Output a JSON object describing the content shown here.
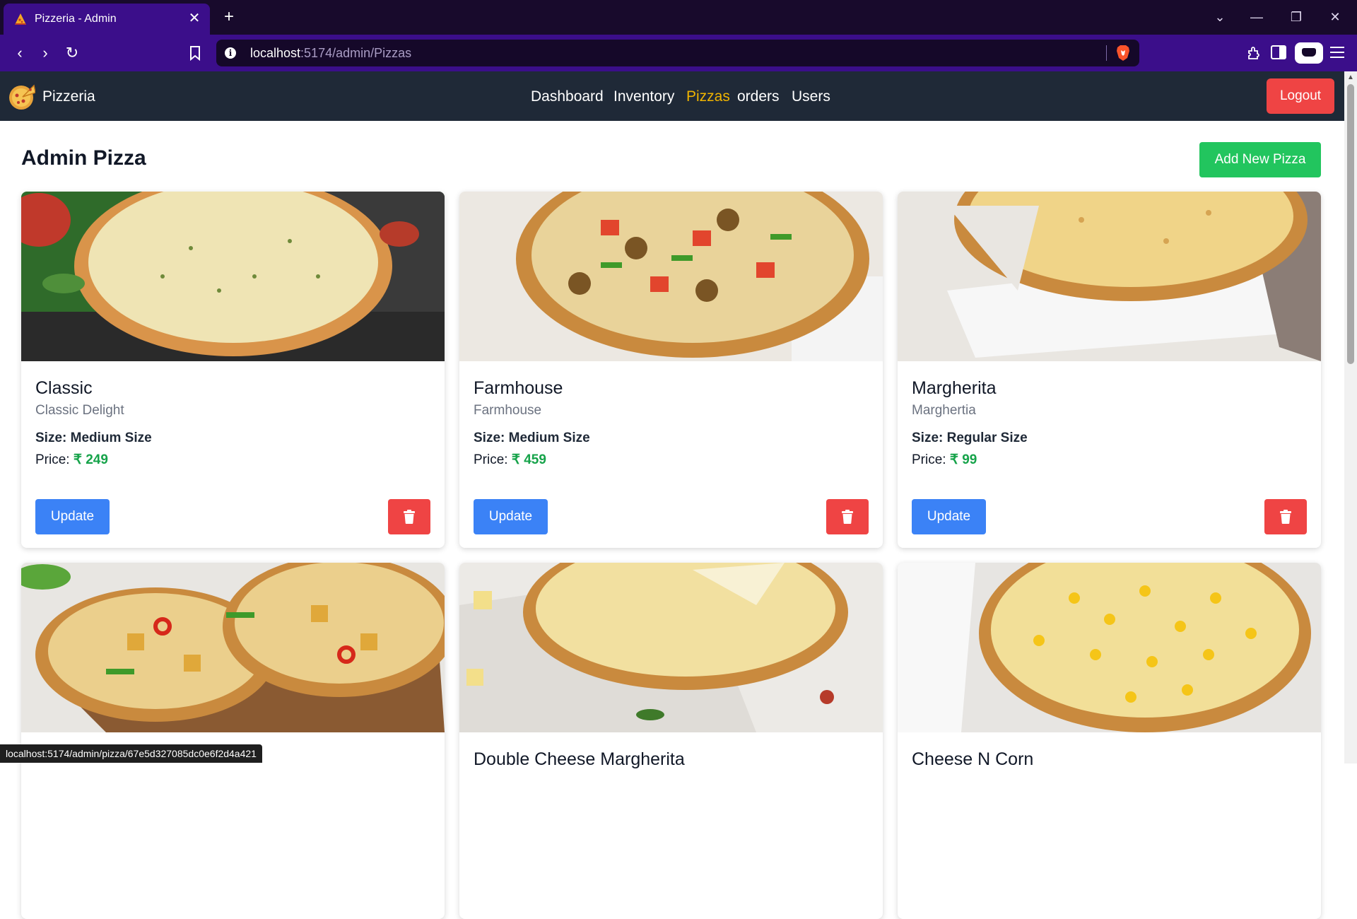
{
  "browser": {
    "tab_title": "Pizzeria - Admin",
    "url_host": "localhost",
    "url_path": ":5174/admin/Pizzas",
    "status_url": "localhost:5174/admin/pizza/67e5d327085dc0e6f2d4a421"
  },
  "app": {
    "brand": "Pizzeria",
    "nav": {
      "dashboard": "Dashboard",
      "inventory": "Inventory",
      "pizzas": "Pizzas",
      "orders": "orders",
      "users": "Users"
    },
    "active_nav": "Pizzas",
    "logout": "Logout"
  },
  "page": {
    "title": "Admin Pizza",
    "add_button": "Add New Pizza"
  },
  "labels": {
    "size_prefix": "Size: ",
    "price_prefix": "Price: ",
    "update": "Update"
  },
  "pizzas": [
    {
      "name": "Classic",
      "description": "Classic Delight",
      "size": "Medium Size",
      "price": "₹ 249"
    },
    {
      "name": "Farmhouse",
      "description": "Farmhouse",
      "size": "Medium Size",
      "price": "₹ 459"
    },
    {
      "name": "Margherita",
      "description": "Marghertia",
      "size": "Regular Size",
      "price": "₹ 99"
    },
    {
      "name": "",
      "description": "",
      "size": "",
      "price": ""
    },
    {
      "name": "Double Cheese Margherita",
      "description": "",
      "size": "",
      "price": ""
    },
    {
      "name": "Cheese N Corn",
      "description": "",
      "size": "",
      "price": ""
    }
  ],
  "colors": {
    "browser_tabbar": "#180a2c",
    "browser_toolbar": "#3b0e8a",
    "app_header": "#1f2937",
    "active_nav": "#f0b400",
    "danger": "#ef4444",
    "success": "#22c55e",
    "primary": "#3b82f6",
    "price": "#16a34a"
  },
  "icons": [
    "pizza-favicon-icon",
    "close-icon",
    "plus-icon",
    "chevron-down-icon",
    "minimize-icon",
    "restore-icon",
    "back-icon",
    "forward-icon",
    "reload-icon",
    "bookmark-icon",
    "info-icon",
    "brave-shield-icon",
    "extensions-icon",
    "sidebar-icon",
    "menu-icon",
    "pizza-logo-icon",
    "trash-icon"
  ]
}
